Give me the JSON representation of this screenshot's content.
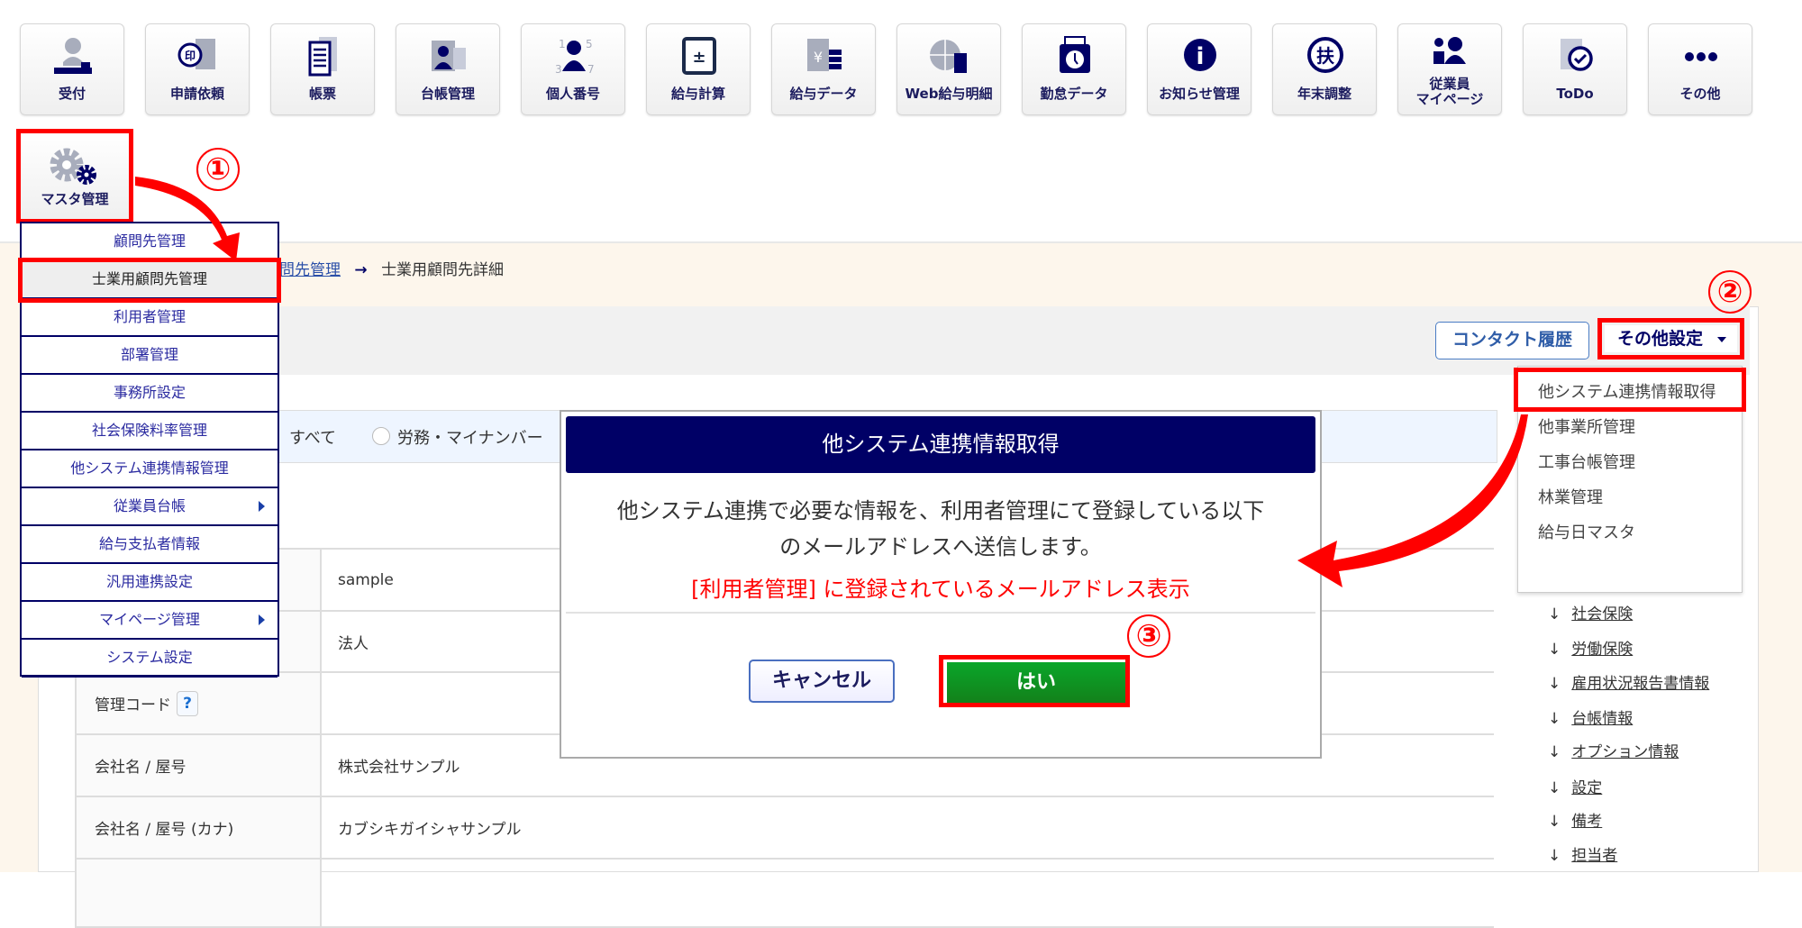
{
  "toolbar": {
    "items": [
      {
        "label": "受付",
        "icon": "reception-stamp-icon"
      },
      {
        "label": "申請依頼",
        "icon": "seal-request-icon"
      },
      {
        "label": "帳票",
        "icon": "document-list-icon"
      },
      {
        "label": "台帳管理",
        "icon": "ledger-card-icon"
      },
      {
        "label": "個人番号",
        "icon": "personal-number-icon"
      },
      {
        "label": "給与計算",
        "icon": "calculator-icon"
      },
      {
        "label": "給与データ",
        "icon": "payroll-data-icon"
      },
      {
        "label": "Web給与明細",
        "icon": "web-payslip-icon"
      },
      {
        "label": "勤怠データ",
        "icon": "timecard-icon"
      },
      {
        "label": "お知らせ管理",
        "icon": "info-icon"
      },
      {
        "label": "年末調整",
        "icon": "year-end-adjustment-icon"
      },
      {
        "label": "従業員",
        "label2": "マイページ",
        "icon": "employee-mypage-icon"
      },
      {
        "label": "ToDo",
        "icon": "todo-check-icon"
      },
      {
        "label": "その他",
        "icon": "more-dots-icon"
      }
    ],
    "master": {
      "label": "マスタ管理",
      "icon": "gear-icon"
    }
  },
  "master_menu": {
    "items": [
      {
        "label": "顧問先管理"
      },
      {
        "label": "士業用顧問先管理",
        "selected": true
      },
      {
        "label": "利用者管理"
      },
      {
        "label": "部署管理"
      },
      {
        "label": "事務所設定"
      },
      {
        "label": "社会保険料率管理"
      },
      {
        "label": "他システム連携情報管理"
      },
      {
        "label": "従業員台帳",
        "submenu": true
      },
      {
        "label": "給与支払者情報"
      },
      {
        "label": "汎用連携設定"
      },
      {
        "label": "マイページ管理",
        "submenu": true
      },
      {
        "label": "システム設定"
      }
    ]
  },
  "breadcrumb": {
    "link": "問先管理",
    "separator": "→",
    "current": "士業用顧問先詳細"
  },
  "header_buttons": {
    "contact_history": "コンタクト履歴",
    "other_settings": "その他設定"
  },
  "other_settings_menu": [
    "他システム連携情報取得",
    "他事業所管理",
    "工事台帳管理",
    "林業管理",
    "給与日マスタ"
  ],
  "filter": {
    "all": "すべて",
    "labor": "労務・マイナンバー"
  },
  "table": {
    "rows": [
      {
        "key": "",
        "value": "sample"
      },
      {
        "key": "",
        "value": "法人"
      },
      {
        "key": "管理コード",
        "value": "",
        "help": "?"
      },
      {
        "key": "会社名 / 屋号",
        "value": "株式会社サンプル"
      },
      {
        "key": "会社名 / 屋号 (カナ)",
        "value": "カブシキガイシャサンプル"
      },
      {
        "key": "",
        "value": ""
      }
    ]
  },
  "section_links": [
    "社会保険",
    "労働保険",
    "雇用状況報告書情報",
    "台帳情報",
    "オプション情報",
    "設定",
    "備考",
    "担当者"
  ],
  "dialog": {
    "title": "他システム連携情報取得",
    "line1": "他システム連携で必要な情報を、利用者管理にて登録している以下",
    "line2": "のメールアドレスへ送信します。",
    "note": "[利用者管理] に登録されているメールアドレス表示",
    "cancel": "キャンセル",
    "ok": "はい"
  },
  "annotations": {
    "step1": "①",
    "step2": "②",
    "step3": "③"
  },
  "colors": {
    "navy": "#000066",
    "highlight": "#ff0000",
    "ok_green": "#0a9a22",
    "page_bg": "#fdf6ec"
  }
}
